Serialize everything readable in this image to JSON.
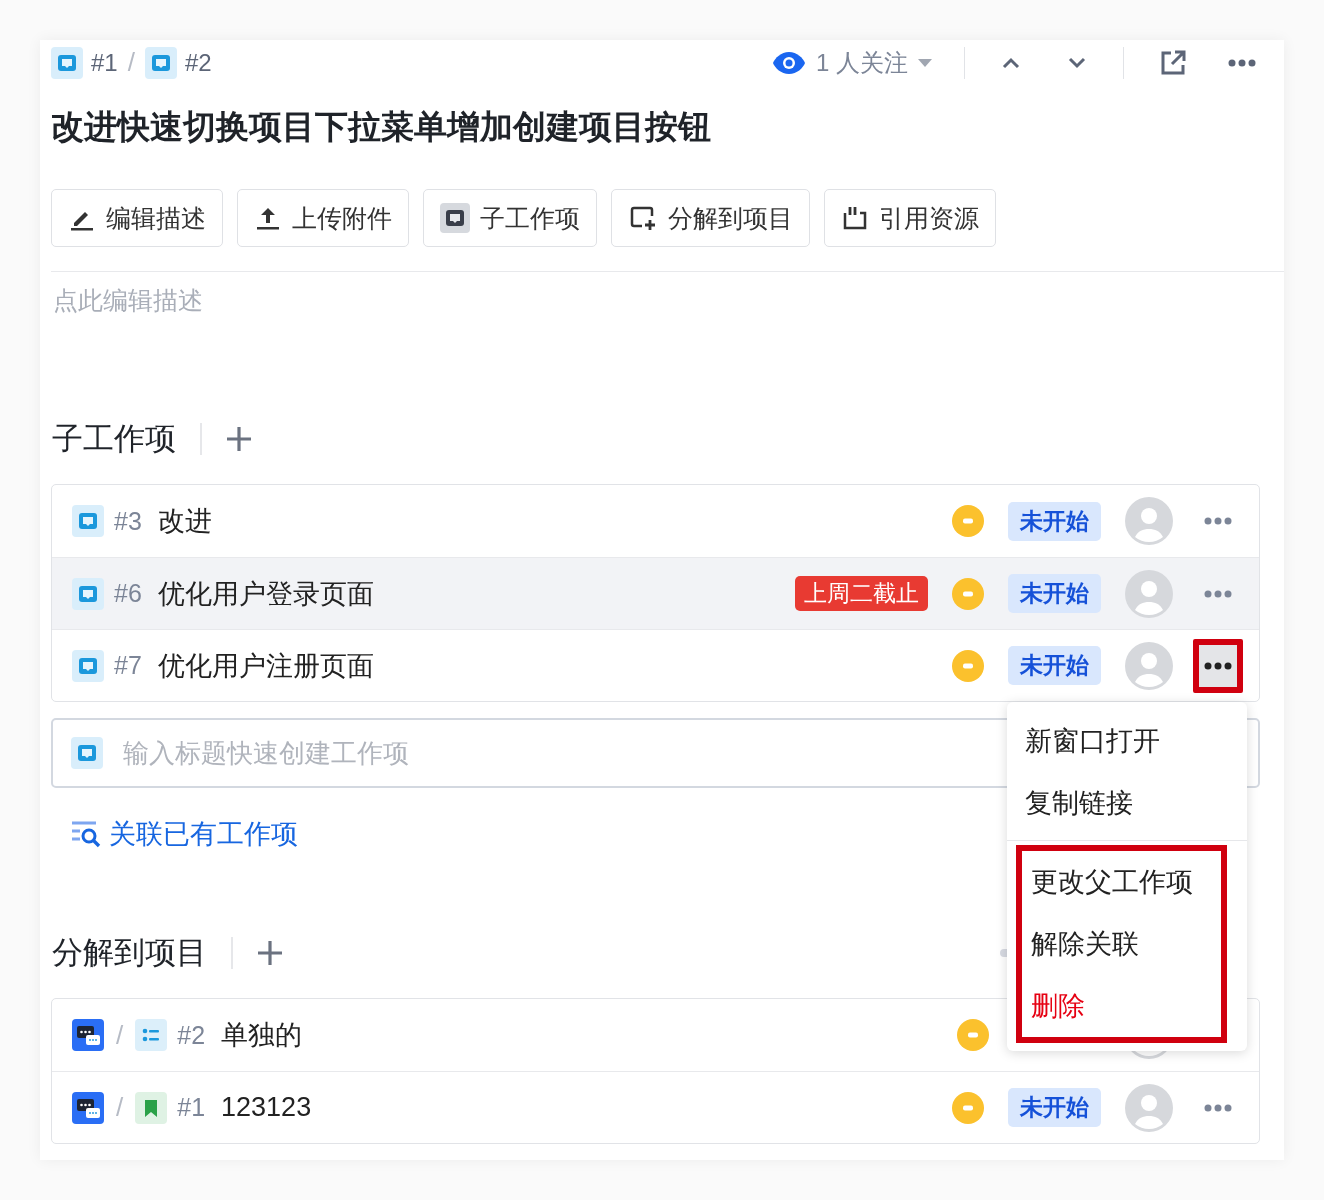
{
  "breadcrumb": [
    {
      "label": "#1"
    },
    {
      "separator": "/",
      "label": "#2"
    }
  ],
  "header": {
    "watchers": "1 人关注"
  },
  "title": "改进快速切换项目下拉菜单增加创建项目按钮",
  "toolbar": [
    {
      "kind": "edit",
      "label": "编辑描述"
    },
    {
      "kind": "upload",
      "label": "上传附件"
    },
    {
      "kind": "subitem",
      "label": "子工作项"
    },
    {
      "kind": "breakdown",
      "label": "分解到项目"
    },
    {
      "kind": "quote",
      "label": "引用资源"
    }
  ],
  "description": {
    "placeholder": "点此编辑描述"
  },
  "sub_items": {
    "title": "子工作项",
    "rows": [
      {
        "number": "#3",
        "title": "改进",
        "status": "未开始",
        "hovered": false,
        "more_highlighted": false
      },
      {
        "number": "#6",
        "title": "优化用户登录页面",
        "deadline": "上周二截止",
        "status": "未开始",
        "hovered": true,
        "more_highlighted": false
      },
      {
        "number": "#7",
        "title": "优化用户注册页面",
        "status": "未开始",
        "hovered": false,
        "more_highlighted": true
      }
    ],
    "quick_create": {
      "placeholder": "输入标题快速创建工作项"
    },
    "link": "关联已有工作项"
  },
  "breakdown": {
    "title": "分解到项目",
    "progress": {
      "level": 0
    },
    "rows": [
      {
        "kind": "list",
        "separator": "/",
        "number": "#2",
        "title": "单独的"
      },
      {
        "kind": "bookmark",
        "separator": "/",
        "number": "#1",
        "title": "123123",
        "status": "未开始"
      }
    ]
  },
  "menu": {
    "groups": [
      {
        "highlighted": false,
        "items": [
          {
            "label": "新窗口打开",
            "danger": false
          },
          {
            "label": "复制链接",
            "danger": false
          }
        ]
      },
      {
        "highlighted": true,
        "items": [
          {
            "label": "更改父工作项",
            "danger": false
          },
          {
            "label": "解除关联",
            "danger": false
          },
          {
            "label": "删除",
            "danger": true
          }
        ]
      }
    ]
  }
}
